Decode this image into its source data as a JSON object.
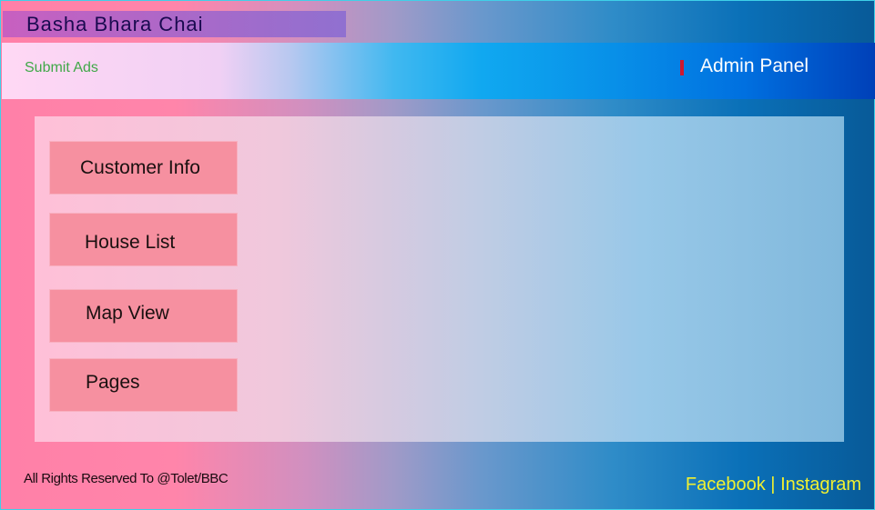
{
  "header": {
    "brand": "Basha Bhara Chai",
    "submit_ads": "Submit Ads",
    "admin_panel": "Admin Panel"
  },
  "menu": [
    {
      "label": "Customer Info"
    },
    {
      "label": "House List"
    },
    {
      "label": "Map View"
    },
    {
      "label": "Pages"
    }
  ],
  "footer": {
    "rights": "All Rights Reserved To @Tolet/BBC",
    "facebook": "Facebook",
    "separator": " | ",
    "instagram": "Instagram"
  },
  "colors": {
    "accent_bar": "#d01830",
    "submit_link": "#40a848",
    "social": "#f0f030"
  }
}
